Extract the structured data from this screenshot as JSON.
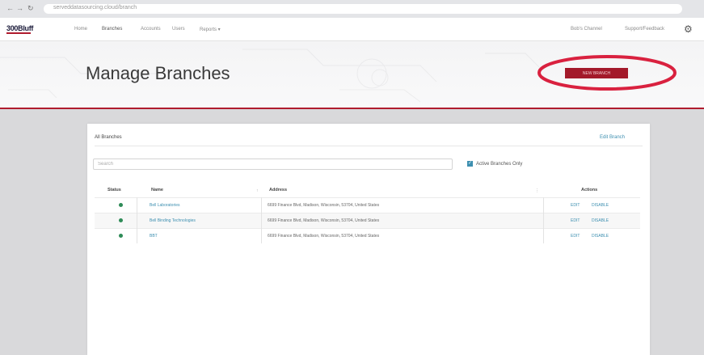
{
  "browser": {
    "back": "←",
    "forward": "→",
    "reload": "↻",
    "url": "serveddatasourcing.cloud/branch"
  },
  "header": {
    "logo": "300Bluff",
    "nav": [
      "Home",
      "Branches",
      "Accounts",
      "Users",
      "Reports ▾"
    ],
    "right_links": [
      "Bob's Channel",
      "Support/Feedback"
    ],
    "settings_icon": "gear-icon"
  },
  "page": {
    "title": "Manage Branches",
    "primary_button": "NEW BRANCH"
  },
  "card": {
    "title": "All Branches",
    "link": "Edit Branch",
    "search_placeholder": "Search",
    "filter_label": "Active Branches Only",
    "filter_checked": true
  },
  "table": {
    "headers": [
      "Status",
      "Name",
      "Address",
      "Actions"
    ],
    "rows": [
      {
        "status": "active",
        "name": "Bell Laboratories",
        "address": "6699 Finance Blvd, Madison, Wisconsin, 53704, United States",
        "edit": "EDIT",
        "disable": "DISABLE"
      },
      {
        "status": "active",
        "name": "Bell Binding Technologies",
        "address": "6699 Finance Blvd, Madison, Wisconsin, 53704, United States",
        "edit": "EDIT",
        "disable": "DISABLE"
      },
      {
        "status": "active",
        "name": "BBT",
        "address": "6699 Finance Blvd, Madison, Wisconsin, 53704, United States",
        "edit": "EDIT",
        "disable": "DISABLE"
      }
    ]
  },
  "colors": {
    "brand_red": "#a3192a",
    "link_blue": "#3d8fb0",
    "status_green": "#2e8b57",
    "highlight_ring": "#d9213f"
  }
}
